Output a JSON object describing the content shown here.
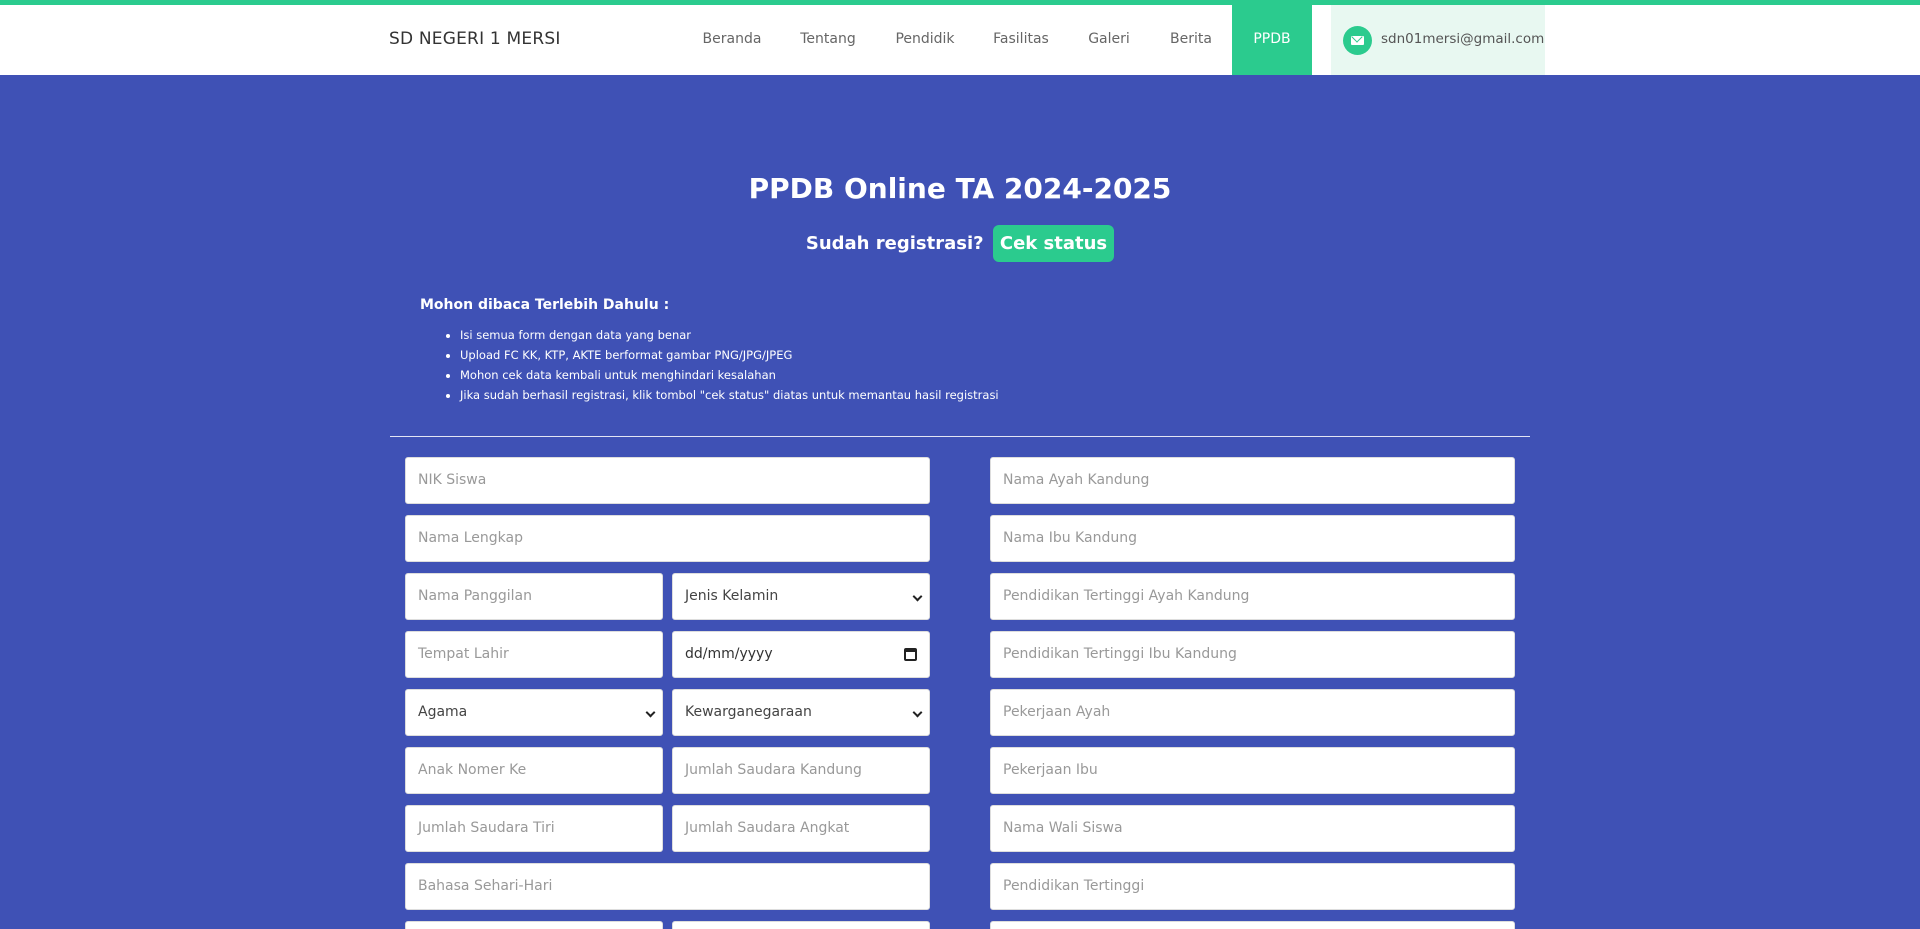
{
  "brand": "SD NEGERI 1 MERSI",
  "nav": {
    "items": [
      "Beranda",
      "Tentang",
      "Pendidik",
      "Fasilitas",
      "Galeri",
      "Berita",
      "PPDB"
    ],
    "active": "PPDB",
    "email": "sdn01mersi@gmail.com"
  },
  "hero": {
    "title": "PPDB Online TA 2024-2025",
    "status_prompt": "Sudah registrasi?",
    "status_button": "Cek status"
  },
  "notice": {
    "title": "Mohon dibaca Terlebih Dahulu :",
    "items": [
      "Isi semua form dengan data yang benar",
      "Upload FC KK, KTP, AKTE berformat gambar PNG/JPG/JPEG",
      "Mohon cek data kembali untuk menghindari kesalahan",
      "Jika sudah berhasil registrasi, klik tombol \"cek status\" diatas untuk memantau hasil registrasi"
    ]
  },
  "form": {
    "left": {
      "nik": "NIK Siswa",
      "nama_lengkap": "Nama Lengkap",
      "nama_panggilan": "Nama Panggilan",
      "jenis_kelamin": "Jenis Kelamin",
      "tempat_lahir": "Tempat Lahir",
      "tanggal_lahir": "dd/mm/yyyy",
      "agama": "Agama",
      "kewarganegaraan": "Kewarganegaraan",
      "anak_nomer_ke": "Anak Nomer Ke",
      "jumlah_saudara_kandung": "Jumlah Saudara Kandung",
      "jumlah_saudara_tiri": "Jumlah Saudara Tiri",
      "jumlah_saudara_angkat": "Jumlah Saudara Angkat",
      "bahasa": "Bahasa Sehari-Hari"
    },
    "right": {
      "nama_ayah": "Nama Ayah Kandung",
      "nama_ibu": "Nama Ibu Kandung",
      "pendidikan_ayah": "Pendidikan Tertinggi Ayah Kandung",
      "pendidikan_ibu": "Pendidikan Tertinggi Ibu Kandung",
      "pekerjaan_ayah": "Pekerjaan Ayah",
      "pekerjaan_ibu": "Pekerjaan Ibu",
      "nama_wali": "Nama Wali Siswa",
      "pendidikan_wali": "Pendidikan Tertinggi"
    }
  },
  "colors": {
    "accent": "#2bcb8e",
    "background": "#3f51b5"
  }
}
